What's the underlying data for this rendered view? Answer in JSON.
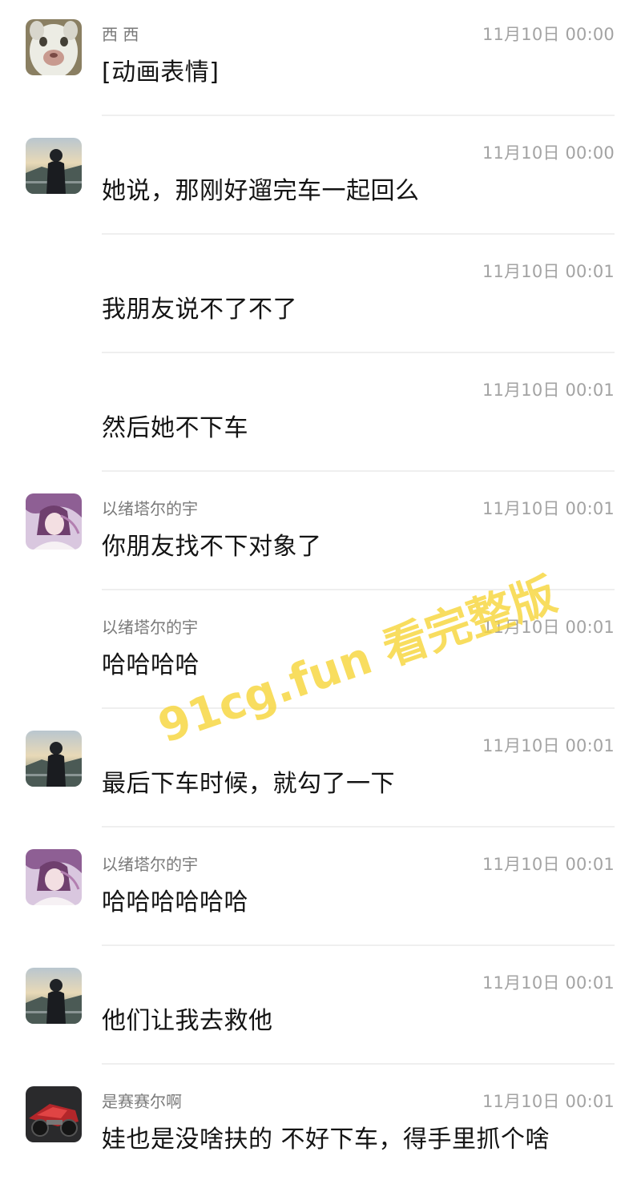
{
  "messages": [
    {
      "sender": "西 西",
      "time": "11月10日 00:00",
      "text": "[动画表情]",
      "avatar": "cat-avatar"
    },
    {
      "sender": "",
      "time": "11月10日 00:00",
      "text": "她说，那刚好遛完车一起回么",
      "avatar": "rider-avatar"
    },
    {
      "sender": "",
      "time": "11月10日 00:01",
      "text": "我朋友说不了不了",
      "avatar": ""
    },
    {
      "sender": "",
      "time": "11月10日 00:01",
      "text": "然后她不下车",
      "avatar": ""
    },
    {
      "sender": "以绪塔尔的宇",
      "time": "11月10日 00:01",
      "text": "你朋友找不下对象了",
      "avatar": "anime-avatar"
    },
    {
      "sender": "以绪塔尔的宇",
      "time": "11月10日 00:01",
      "text": "哈哈哈哈",
      "avatar": ""
    },
    {
      "sender": "",
      "time": "11月10日 00:01",
      "text": "最后下车时候，就勾了一下",
      "avatar": "rider-avatar"
    },
    {
      "sender": "以绪塔尔的宇",
      "time": "11月10日 00:01",
      "text": "哈哈哈哈哈哈",
      "avatar": "anime-avatar"
    },
    {
      "sender": "",
      "time": "11月10日 00:01",
      "text": "他们让我去救他",
      "avatar": "rider-avatar"
    },
    {
      "sender": "是赛赛尔啊",
      "time": "11月10日 00:01",
      "text": "娃也是没啥扶的 不好下车，得手里抓个啥",
      "avatar": "motorbike-avatar"
    }
  ],
  "watermark": "91cg.fun 看完整版",
  "colors": {
    "background": "#ffffff",
    "text": "#141414",
    "sender": "#7a7a7a",
    "time": "#a3a3a3",
    "divider": "#efefef",
    "watermark": "#f6d63c"
  }
}
